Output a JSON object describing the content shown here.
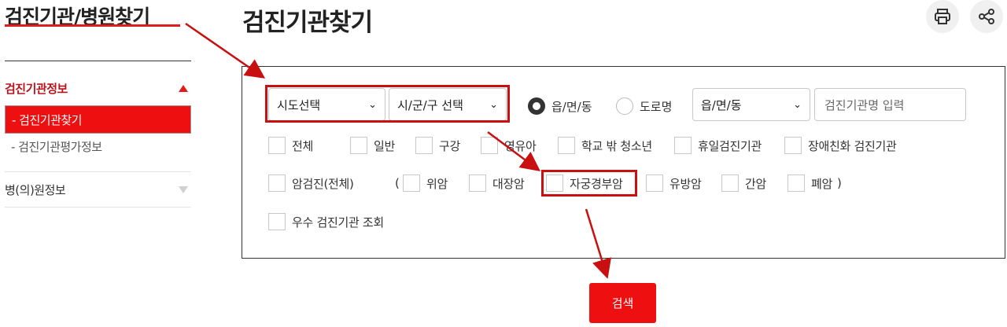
{
  "sidebar": {
    "title": "검진기관/병원찾기",
    "sections": [
      {
        "label": "검진기관정보",
        "items": [
          "-  검진기관찾기",
          "-  검진기관평가정보"
        ]
      },
      {
        "label": "병(의)원정보"
      }
    ]
  },
  "header": {
    "title": "검진기관찾기",
    "print_icon": "printer-icon",
    "share_icon": "share-icon"
  },
  "search": {
    "sido_select": "시도선택",
    "sigungu_select": "시/군/구 선택",
    "radios": [
      {
        "label": "읍/면/동",
        "checked": true
      },
      {
        "label": "도로명",
        "checked": false
      }
    ],
    "dong_select": "읍/면/동",
    "name_placeholder": "검진기관명 입력",
    "checkboxes_row1": [
      "전체",
      "일반",
      "구강",
      "영유아",
      "학교 밖 청소년",
      "휴일검진기관",
      "장애친화 검진기관"
    ],
    "checkboxes_row2": {
      "all": "암검진(전체)",
      "open_paren": "(",
      "items": [
        "위암",
        "대장암",
        "자궁경부암",
        "유방암",
        "간암",
        "폐암"
      ],
      "close_paren": ")"
    },
    "excellent": "우수 검진기관 조회",
    "button": "검색"
  },
  "annotation": {
    "color": "#c81010"
  },
  "colors": {
    "accent": "#ee1010",
    "active_text": "#b8131b"
  }
}
